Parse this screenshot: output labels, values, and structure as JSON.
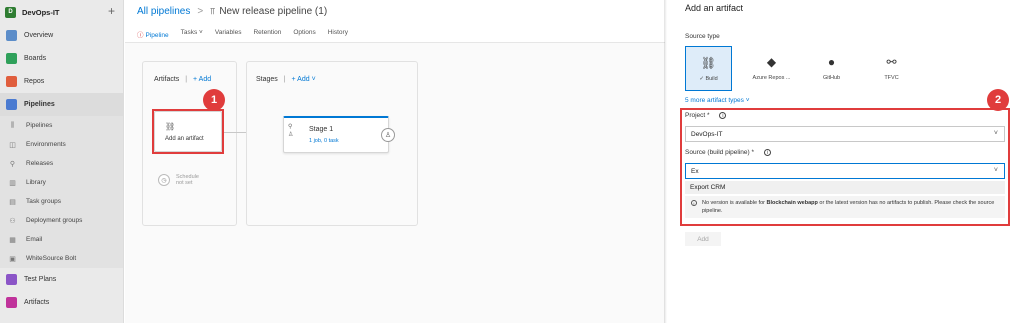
{
  "org": {
    "name": "DevOps-IT",
    "logo_text": "D",
    "plus": "+"
  },
  "sidebar": {
    "items": [
      {
        "label": "Overview",
        "icon": "overview-icon",
        "color": "#5c8dc9"
      },
      {
        "label": "Boards",
        "icon": "boards-icon",
        "color": "#2fa05a"
      },
      {
        "label": "Repos",
        "icon": "repos-icon",
        "color": "#e05e3d"
      },
      {
        "label": "Pipelines",
        "icon": "pipelines-icon",
        "color": "#4b7bd1"
      }
    ],
    "sub_items": [
      {
        "label": "Pipelines",
        "icon": "pipelines-sub-icon",
        "glyph": "⫼"
      },
      {
        "label": "Environments",
        "icon": "environments-icon",
        "glyph": "◫"
      },
      {
        "label": "Releases",
        "icon": "releases-icon",
        "glyph": "⚲"
      },
      {
        "label": "Library",
        "icon": "library-icon",
        "glyph": "▥"
      },
      {
        "label": "Task groups",
        "icon": "task-groups-icon",
        "glyph": "▤"
      },
      {
        "label": "Deployment groups",
        "icon": "deployment-groups-icon",
        "glyph": "⚇"
      },
      {
        "label": "Email",
        "icon": "email-icon",
        "glyph": "▦"
      },
      {
        "label": "WhiteSource Bolt",
        "icon": "whitesource-icon",
        "glyph": "▣"
      }
    ],
    "bottom_items": [
      {
        "label": "Test Plans",
        "icon": "test-plans-icon",
        "color": "#8b55c7"
      },
      {
        "label": "Artifacts",
        "icon": "artifacts-icon",
        "color": "#c0339b"
      }
    ]
  },
  "breadcrumb": {
    "link": "All pipelines",
    "sep": ">",
    "icon": "⫪",
    "title": "New release pipeline (1)"
  },
  "tabs": [
    {
      "label": "Pipeline",
      "active": true,
      "warn": "ⓘ"
    },
    {
      "label": "Tasks ˅"
    },
    {
      "label": "Variables"
    },
    {
      "label": "Retention"
    },
    {
      "label": "Options"
    },
    {
      "label": "History"
    }
  ],
  "canvas": {
    "artifacts_title": "Artifacts",
    "stages_title": "Stages",
    "sep": "|",
    "add_label": "+ Add",
    "stages_add_label": "+ Add ˅",
    "artifact_card_label": "Add an artifact",
    "schedule_label_1": "Schedule",
    "schedule_label_2": "not set",
    "stage_name": "Stage 1",
    "stage_sub": "1 job, 0 task",
    "badge1": "1",
    "badge2": "2"
  },
  "panel": {
    "title": "Add an artifact",
    "source_type_label": "Source type",
    "source_types": [
      {
        "label": "✓ Build",
        "icon": "build-icon",
        "glyph": "⛓",
        "selected": true
      },
      {
        "label": "Azure Repos ...",
        "icon": "azure-repos-icon",
        "glyph": "◆"
      },
      {
        "label": "GitHub",
        "icon": "github-icon",
        "glyph": "●"
      },
      {
        "label": "TFVC",
        "icon": "tfvc-icon",
        "glyph": "⚯"
      }
    ],
    "more_types": "5 more artifact types ˅",
    "project_label": "Project *",
    "project_value": "DevOps-IT",
    "source_label": "Source (build pipeline) *",
    "source_value": "Ex",
    "option": "Export CRM",
    "message_part1": "No version is available for ",
    "message_bold": "Blockchain webapp",
    "message_part2": " or the latest version has no artifacts to publish. Please check the source pipeline.",
    "add_button": "Add",
    "info_glyph": "i",
    "caret": "˅"
  },
  "colors": {
    "accent": "#0078d4",
    "highlight": "#e03c3c"
  }
}
